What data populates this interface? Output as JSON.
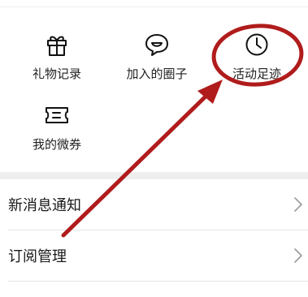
{
  "grid": {
    "items": [
      {
        "label": "礼物记录",
        "icon": "gift-icon"
      },
      {
        "label": "加入的圈子",
        "icon": "chat-smile-icon"
      },
      {
        "label": "活动足迹",
        "icon": "clock-icon"
      },
      {
        "label": "我的微券",
        "icon": "ticket-icon"
      }
    ]
  },
  "settings": {
    "items": [
      {
        "label": "新消息通知",
        "icon": "chevron-right-icon"
      },
      {
        "label": "订阅管理",
        "icon": "chevron-right-icon"
      }
    ]
  },
  "annotation": {
    "color": "#b01c1c",
    "shapes": [
      "circle-highlight",
      "arrow"
    ]
  }
}
